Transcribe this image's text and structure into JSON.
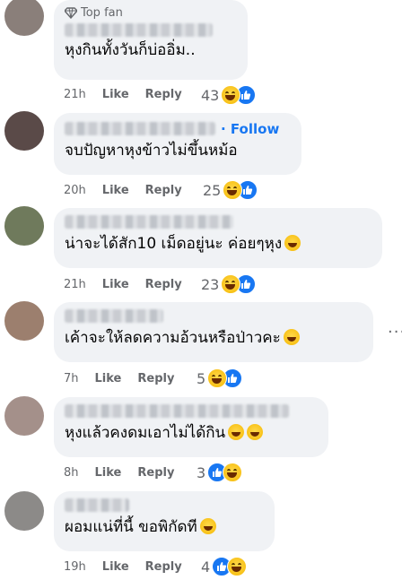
{
  "comments": [
    {
      "badge": "Top fan",
      "text": "หุงกินทั้งวันก็บ่ออิ่ม..",
      "inline_emoji": "",
      "time": "21h",
      "like": "Like",
      "reply": "Reply",
      "count": "43",
      "reactions": [
        "haha",
        "like"
      ],
      "follow": ""
    },
    {
      "badge": "",
      "text": "จบปัญหาหุงข้าวไม่ขึ้นหม้อ",
      "inline_emoji": "",
      "time": "20h",
      "like": "Like",
      "reply": "Reply",
      "count": "25",
      "reactions": [
        "haha",
        "like"
      ],
      "follow": "· Follow"
    },
    {
      "badge": "",
      "text": "น่าจะได้สัก10 เม็ดอยู่นะ ค่อยๆหุง",
      "inline_emoji": "grinning-sweat",
      "time": "21h",
      "like": "Like",
      "reply": "Reply",
      "count": "23",
      "reactions": [
        "haha",
        "like"
      ],
      "follow": ""
    },
    {
      "badge": "",
      "text": "เค้าจะให้ลดความอ้วนหรือป่าวคะ",
      "inline_emoji": "rofl",
      "time": "7h",
      "like": "Like",
      "reply": "Reply",
      "count": "5",
      "reactions": [
        "haha",
        "like"
      ],
      "follow": ""
    },
    {
      "badge": "",
      "text": "หุงแล้วคงดมเอาไม่ได้กิน",
      "inline_emoji": "grin-grin",
      "time": "8h",
      "like": "Like",
      "reply": "Reply",
      "count": "3",
      "reactions": [
        "like",
        "haha"
      ],
      "follow": ""
    },
    {
      "badge": "",
      "text": "ผอมแน่ที่นี้ ขอพิกัดที",
      "inline_emoji": "joy",
      "time": "19h",
      "like": "Like",
      "reply": "Reply",
      "count": "4",
      "reactions": [
        "like",
        "haha"
      ],
      "follow": ""
    }
  ],
  "more_glyph": "···",
  "colors": {
    "bubble": "#f0f2f5",
    "accent": "#1877f2",
    "meta": "#65676b",
    "text": "#050505"
  }
}
